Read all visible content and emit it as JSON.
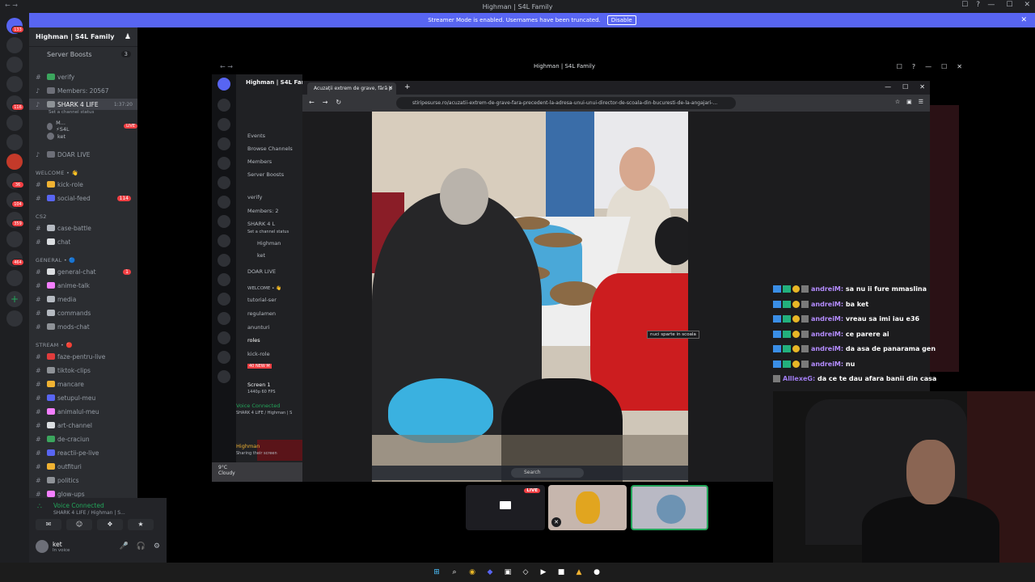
{
  "window": {
    "title": "Highman | S4L Family",
    "nav": "← →",
    "tools": [
      "☐",
      "?"
    ],
    "controls": [
      "—",
      "☐",
      "✕"
    ]
  },
  "banner": {
    "text": "Streamer Mode is enabled. Usernames have been truncated.",
    "button": "Disable",
    "close": "✕"
  },
  "rail": {
    "badges": [
      "133",
      "116",
      "36",
      "104",
      "359",
      "464"
    ]
  },
  "sidebar": {
    "guild_name": "Highman | S4L Family",
    "boosts_label": "Server Boosts",
    "boosts_count": "3",
    "channels": [
      {
        "label": "verify",
        "type": "text"
      },
      {
        "label": "Members: 20567",
        "type": "voice"
      },
      {
        "label": "SHARK 4 LIFE",
        "type": "voice",
        "active": true,
        "time": "1:37:20"
      },
      {
        "label": "DOAR LIVE",
        "type": "voice"
      },
      {
        "label": "kick-role",
        "type": "text"
      },
      {
        "label": "social-feed",
        "type": "text",
        "badge": "114"
      },
      {
        "label": "case-battle",
        "type": "text"
      },
      {
        "label": "chat",
        "type": "text"
      },
      {
        "label": "general-chat",
        "type": "text",
        "badge": "1"
      },
      {
        "label": "anime-talk",
        "type": "text"
      },
      {
        "label": "media",
        "type": "text"
      },
      {
        "label": "commands",
        "type": "text"
      },
      {
        "label": "mods-chat",
        "type": "text"
      },
      {
        "label": "faze-pentru-live",
        "type": "text"
      },
      {
        "label": "tiktok-clips",
        "type": "text"
      },
      {
        "label": "mancare",
        "type": "text"
      },
      {
        "label": "setupul-meu",
        "type": "text"
      },
      {
        "label": "animalul-meu",
        "type": "text"
      },
      {
        "label": "art-channel",
        "type": "text"
      },
      {
        "label": "de-craciun",
        "type": "text"
      },
      {
        "label": "reactii-pe-live",
        "type": "text"
      },
      {
        "label": "outfituri",
        "type": "text"
      },
      {
        "label": "politics",
        "type": "text"
      },
      {
        "label": "glow-ups",
        "type": "text"
      }
    ],
    "channel_status": "Set a channel status",
    "categories": [
      "WELCOME • 👋",
      "CS2",
      "GENERAL • 🔵",
      "STREAM • 🔴"
    ],
    "voice_users": [
      {
        "name": "M... ⚡S4L",
        "live": "LIVE"
      },
      {
        "name": "ket"
      }
    ]
  },
  "voice_panel": {
    "title": "Voice Connected",
    "sub": "SHARK 4 LIFE / Highman | S...",
    "buttons": [
      "✉",
      "☺",
      "❖",
      "★"
    ],
    "user_name": "ket",
    "user_status": "In voice",
    "controls": [
      "🎤",
      "🎧",
      "⚙"
    ]
  },
  "share": {
    "title": "Highman | S4L Family",
    "nav": "← →",
    "icons": [
      "☐",
      "?",
      "—",
      "☐",
      "✕"
    ]
  },
  "inner_discord": {
    "guild": "Highman | S4L Family",
    "items": [
      "Events",
      "Browse Channels",
      "Members",
      "Server Boosts",
      "verify",
      "Members: 2",
      "SHARK 4 L",
      "Set a channel status",
      "Highman",
      "ket",
      "DOAR LIVE",
      "WELCOME • 👋",
      "tutorial-ser",
      "regulamen",
      "anunturi",
      "roles",
      "kick-role",
      "40 NEW M"
    ],
    "screen": "Screen 1",
    "screen_sub": "1440p 60 FPS",
    "voice": "Voice Connected",
    "voice_sub": "SHARK 4 LIFE / Highman | S",
    "user": "Highman",
    "user_sub": "Sharing their screen",
    "weather_temp": "9°C",
    "weather_desc": "Cloudy"
  },
  "browser": {
    "tab_title": "Acuzații extrem de grave, fără p",
    "tab_close": "✕",
    "new_tab": "+",
    "win_controls": [
      "—",
      "☐",
      "✕"
    ],
    "nav": [
      "←",
      "→",
      "↻"
    ],
    "url": "stiripesurse.ro/acuzatii-extrem-de-grave-fara-precedent-la-adresa-unui-unui-director-de-scoala-din-bucuresti-de-la-angajari-...",
    "icons": [
      "☆",
      "▣",
      "☰"
    ],
    "tooltip": "nuci sparte in scoala",
    "search_placeholder": "Search"
  },
  "chat": {
    "messages": [
      {
        "user": "andreiM:",
        "text": "sa nu ii fure mmaslina"
      },
      {
        "user": "andreiM:",
        "text": "ba ket"
      },
      {
        "user": "andreiM:",
        "text": "vreau sa imi iau e36"
      },
      {
        "user": "andreiM:",
        "text": "ce parere ai"
      },
      {
        "user": "andreiM:",
        "text": "da asa de panarama gen"
      },
      {
        "user": "andreiM:",
        "text": "nu"
      },
      {
        "user": "AlllexeG:",
        "text": "da ce te dau afara banii din casa"
      }
    ]
  },
  "thumbs": {
    "live": "LIVE",
    "mute": "✕"
  },
  "taskbar": {
    "icons": [
      "⊞",
      "⌕",
      "◉",
      "◆",
      "▣",
      "◇",
      "▶",
      "■",
      "▲",
      "●"
    ]
  }
}
